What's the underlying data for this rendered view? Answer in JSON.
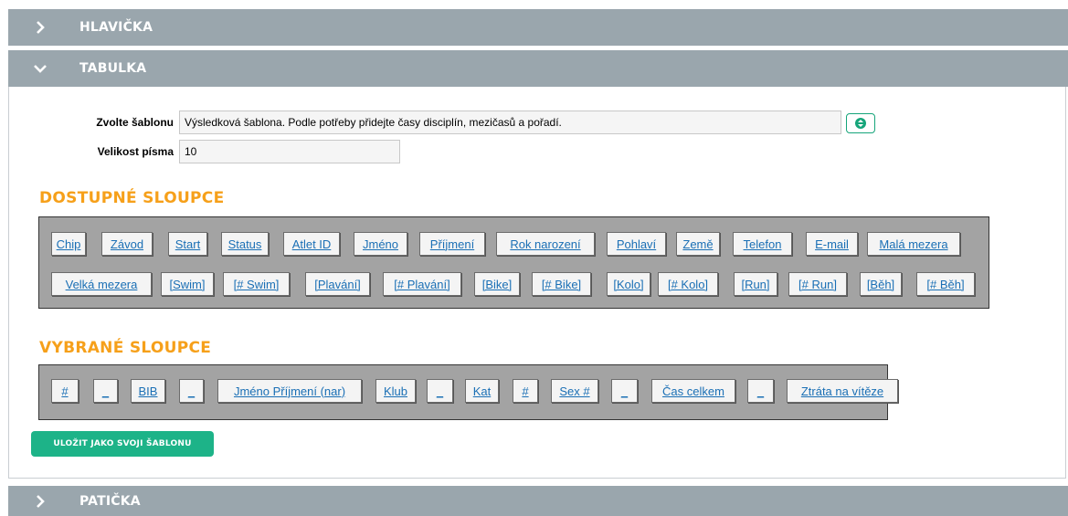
{
  "sections": {
    "header": {
      "title": "HLAVIČKA"
    },
    "table": {
      "title": "TABULKA"
    },
    "footer": {
      "title": "PATIČKA"
    }
  },
  "form": {
    "template_label": "Zvolte šablonu",
    "template_value": "Výsledková šablona. Podle potřeby přidejte časy disciplín, mezičasů a pořadí.",
    "font_size_label": "Velikost písma",
    "font_size_value": "10"
  },
  "available": {
    "heading": "DOSTUPNÉ SLOUPCE",
    "items": [
      "Chip",
      "Závod",
      "Start",
      "Status",
      "Atlet ID",
      "Jméno",
      "Příjmení",
      "Rok narození",
      "Pohlaví",
      "Země",
      "Telefon",
      "E-mail",
      "Malá mezera",
      "Velká mezera",
      "[Swim]",
      "[# Swim]",
      "[Plavání]",
      "[# Plavání]",
      "[Bike]",
      "[# Bike]",
      "[Kolo]",
      "[# Kolo]",
      "[Run]",
      "[# Run]",
      "[Běh]",
      "[# Běh]"
    ]
  },
  "selected": {
    "heading": "VYBRANÉ SLOUPCE",
    "items": [
      "#",
      "_",
      "BIB",
      "_",
      "Jméno Příjmení (nar)",
      "Klub",
      "_",
      "Kat",
      "#",
      "Sex #",
      "_",
      "Čas celkem",
      "_",
      "Ztráta na vítěze"
    ]
  },
  "save_button": "ULOŽIT JAKO SVOJI ŠABLONU",
  "colors": {
    "section_bar": "#9aa6ad",
    "heading_orange": "#f6a01a",
    "accent_green": "#1db388",
    "link_blue": "#1a6fb5"
  }
}
